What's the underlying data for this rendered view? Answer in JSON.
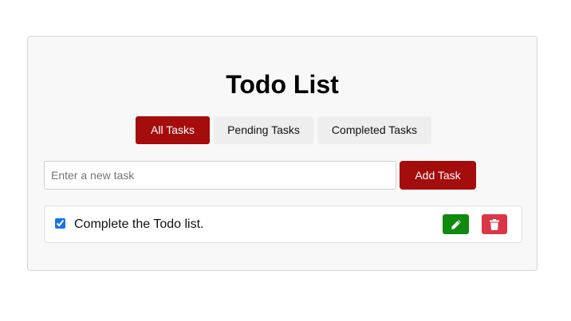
{
  "app": {
    "title": "Todo List"
  },
  "tabs": [
    {
      "label": "All Tasks",
      "active": true
    },
    {
      "label": "Pending Tasks",
      "active": false
    },
    {
      "label": "Completed Tasks",
      "active": false
    }
  ],
  "new_task": {
    "value": "",
    "placeholder": "Enter a new task",
    "add_label": "Add Task"
  },
  "tasks": [
    {
      "text": "Complete the Todo list.",
      "completed": true,
      "edit_icon": "pencil-icon",
      "delete_icon": "trash-icon"
    }
  ],
  "colors": {
    "accent": "#a50c0c",
    "edit": "#0f8a0f",
    "delete": "#dc3545",
    "tab_inactive": "#eeeeee"
  }
}
